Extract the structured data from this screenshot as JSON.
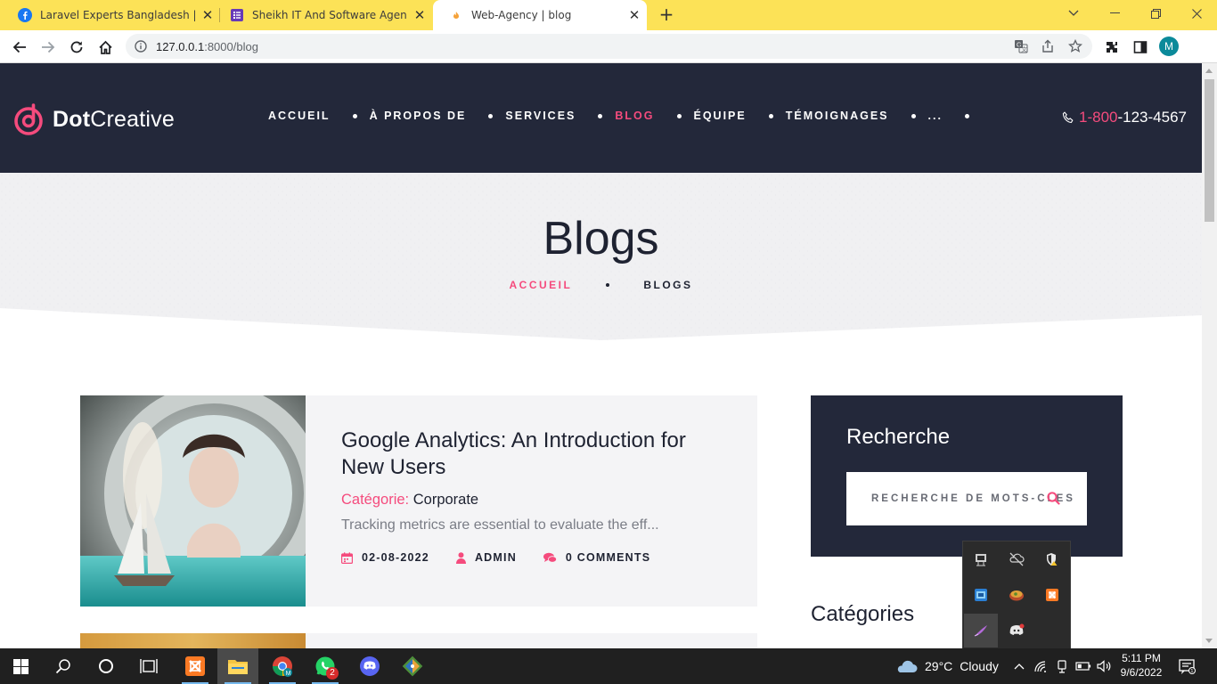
{
  "browser": {
    "tabs": [
      {
        "title": "Laravel Experts Bangladesh | Face",
        "icon": "facebook-icon",
        "active": false
      },
      {
        "title": "Sheikh IT And Software Agency",
        "icon": "form-icon",
        "active": false
      },
      {
        "title": "Web-Agency | blog",
        "icon": "flame-icon",
        "active": true
      }
    ],
    "url_host": "127.0.0.1",
    "url_rest": ":8000/blog",
    "profile_initial": "M",
    "colors": {
      "tabstrip": "#fce257"
    }
  },
  "site": {
    "logo": {
      "strong": "Dot",
      "light": "Creative"
    },
    "nav": [
      {
        "label": "ACCUEIL",
        "active": false
      },
      {
        "label": "À PROPOS DE",
        "active": false
      },
      {
        "label": "SERVICES",
        "active": false
      },
      {
        "label": "BLOG",
        "active": true
      },
      {
        "label": "ÉQUIPE",
        "active": false
      },
      {
        "label": "TÉMOIGNAGES",
        "active": false
      },
      {
        "label": "...",
        "active": false
      }
    ],
    "phone": {
      "prefix": "1-800",
      "rest": "-123-4567"
    },
    "colors": {
      "dark": "#23283a",
      "accent": "#f54b7d"
    }
  },
  "banner": {
    "title": "Blogs",
    "breadcrumb": {
      "home": "ACCUEIL",
      "current": "BLOGS"
    }
  },
  "posts": [
    {
      "title": "Google Analytics: An Introduction for New Users",
      "category_label": "Catégorie:",
      "category": "Corporate",
      "excerpt": "Tracking metrics are essential to evaluate the eff...",
      "date": "02-08-2022",
      "author": "ADMIN",
      "comments": "0 COMMENTS"
    }
  ],
  "sidebar": {
    "search_title": "Recherche",
    "search_placeholder": "RECHERCHE DE MOTS-CLÉS",
    "categories_title": "Catégories"
  },
  "taskbar": {
    "apps": [
      "windows-start-icon",
      "search-icon",
      "cortana-icon",
      "task-view-icon",
      "xampp-icon",
      "file-explorer-icon",
      "chrome-icon",
      "whatsapp-icon",
      "discord-icon",
      "git-icon"
    ],
    "whatsapp_badge": "2",
    "weather": {
      "temp": "29°C",
      "condition": "Cloudy"
    },
    "clock": {
      "time": "5:11 PM",
      "date": "9/6/2022"
    }
  }
}
